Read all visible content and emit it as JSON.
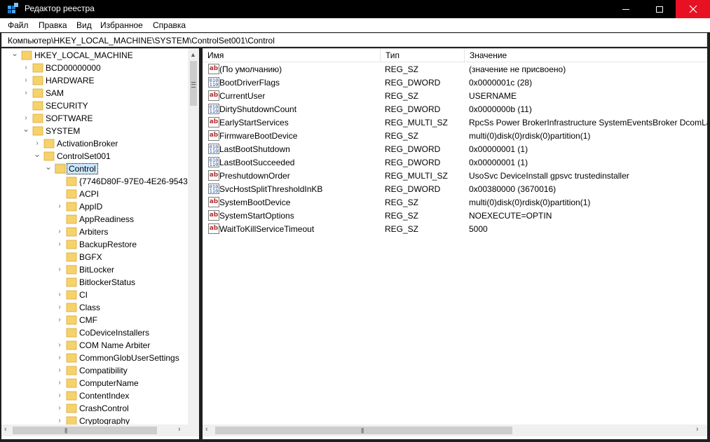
{
  "window": {
    "title": "Редактор реестра",
    "accent_close": "#e81123"
  },
  "menu": {
    "items": [
      "Файл",
      "Правка",
      "Вид",
      "Избранное",
      "Справка"
    ]
  },
  "address": {
    "path": "Компьютер\\HKEY_LOCAL_MACHINE\\SYSTEM\\ControlSet001\\Control"
  },
  "tree": {
    "items": [
      {
        "label": "HKEY_LOCAL_MACHINE",
        "expander": "expanded",
        "level": 0
      },
      {
        "label": "BCD00000000",
        "expander": "collapsed",
        "level": 1
      },
      {
        "label": "HARDWARE",
        "expander": "collapsed",
        "level": 1
      },
      {
        "label": "SAM",
        "expander": "collapsed",
        "level": 1
      },
      {
        "label": "SECURITY",
        "expander": "none",
        "level": 1
      },
      {
        "label": "SOFTWARE",
        "expander": "collapsed",
        "level": 1
      },
      {
        "label": "SYSTEM",
        "expander": "expanded",
        "level": 1
      },
      {
        "label": "ActivationBroker",
        "expander": "collapsed",
        "level": 2
      },
      {
        "label": "ControlSet001",
        "expander": "expanded",
        "level": 2
      },
      {
        "label": "Control",
        "expander": "expanded",
        "level": 3,
        "selected": true
      },
      {
        "label": "{7746D80F-97E0-4E26-9543",
        "expander": "none",
        "level": 4
      },
      {
        "label": "ACPI",
        "expander": "none",
        "level": 4
      },
      {
        "label": "AppID",
        "expander": "collapsed",
        "level": 4
      },
      {
        "label": "AppReadiness",
        "expander": "none",
        "level": 4
      },
      {
        "label": "Arbiters",
        "expander": "collapsed",
        "level": 4
      },
      {
        "label": "BackupRestore",
        "expander": "collapsed",
        "level": 4
      },
      {
        "label": "BGFX",
        "expander": "none",
        "level": 4
      },
      {
        "label": "BitLocker",
        "expander": "collapsed",
        "level": 4
      },
      {
        "label": "BitlockerStatus",
        "expander": "none",
        "level": 4
      },
      {
        "label": "CI",
        "expander": "collapsed",
        "level": 4
      },
      {
        "label": "Class",
        "expander": "collapsed",
        "level": 4
      },
      {
        "label": "CMF",
        "expander": "collapsed",
        "level": 4
      },
      {
        "label": "CoDeviceInstallers",
        "expander": "none",
        "level": 4
      },
      {
        "label": "COM Name Arbiter",
        "expander": "collapsed",
        "level": 4
      },
      {
        "label": "CommonGlobUserSettings",
        "expander": "collapsed",
        "level": 4
      },
      {
        "label": "Compatibility",
        "expander": "collapsed",
        "level": 4
      },
      {
        "label": "ComputerName",
        "expander": "collapsed",
        "level": 4
      },
      {
        "label": "ContentIndex",
        "expander": "collapsed",
        "level": 4
      },
      {
        "label": "CrashControl",
        "expander": "collapsed",
        "level": 4
      },
      {
        "label": "Cryptography",
        "expander": "collapsed",
        "level": 4
      }
    ]
  },
  "values": {
    "columns": [
      "Имя",
      "Тип",
      "Значение"
    ],
    "rows": [
      {
        "icon": "string-value-icon",
        "name": "(По умолчанию)",
        "type": "REG_SZ",
        "data": "(значение не присвоено)"
      },
      {
        "icon": "binary-value-icon",
        "name": "BootDriverFlags",
        "type": "REG_DWORD",
        "data": "0x0000001c (28)"
      },
      {
        "icon": "string-value-icon",
        "name": "CurrentUser",
        "type": "REG_SZ",
        "data": "USERNAME"
      },
      {
        "icon": "binary-value-icon",
        "name": "DirtyShutdownCount",
        "type": "REG_DWORD",
        "data": "0x0000000b (11)"
      },
      {
        "icon": "string-value-icon",
        "name": "EarlyStartServices",
        "type": "REG_MULTI_SZ",
        "data": "RpcSs Power BrokerInfrastructure SystemEventsBroker DcomLau"
      },
      {
        "icon": "string-value-icon",
        "name": "FirmwareBootDevice",
        "type": "REG_SZ",
        "data": "multi(0)disk(0)rdisk(0)partition(1)"
      },
      {
        "icon": "binary-value-icon",
        "name": "LastBootShutdown",
        "type": "REG_DWORD",
        "data": "0x00000001 (1)"
      },
      {
        "icon": "binary-value-icon",
        "name": "LastBootSucceeded",
        "type": "REG_DWORD",
        "data": "0x00000001 (1)"
      },
      {
        "icon": "string-value-icon",
        "name": "PreshutdownOrder",
        "type": "REG_MULTI_SZ",
        "data": "UsoSvc DeviceInstall gpsvc trustedinstaller"
      },
      {
        "icon": "binary-value-icon",
        "name": "SvcHostSplitThresholdInKB",
        "type": "REG_DWORD",
        "data": "0x00380000 (3670016)"
      },
      {
        "icon": "string-value-icon",
        "name": "SystemBootDevice",
        "type": "REG_SZ",
        "data": "multi(0)disk(0)rdisk(0)partition(1)"
      },
      {
        "icon": "string-value-icon",
        "name": "SystemStartOptions",
        "type": "REG_SZ",
        "data": " NOEXECUTE=OPTIN"
      },
      {
        "icon": "string-value-icon",
        "name": "WaitToKillServiceTimeout",
        "type": "REG_SZ",
        "data": "5000"
      }
    ]
  }
}
